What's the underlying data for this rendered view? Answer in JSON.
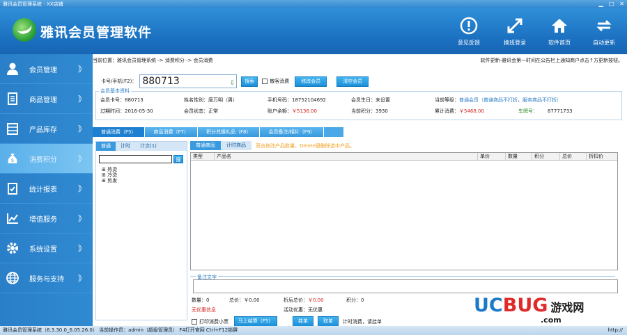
{
  "window": {
    "title": "雅讯会员管理系统 - XX店铺",
    "controls": [
      "▁",
      "□",
      "✕"
    ]
  },
  "app": {
    "title": "雅讯会员管理软件"
  },
  "header_buttons": [
    {
      "label": "意见反馈",
      "icon": "alert-icon"
    },
    {
      "label": "换班登录",
      "icon": "switch-icon"
    },
    {
      "label": "软件首页",
      "icon": "home-icon"
    },
    {
      "label": "自动更新",
      "icon": "refresh-icon"
    }
  ],
  "sidebar": {
    "items": [
      {
        "label": "会员管理",
        "icon": "user-icon"
      },
      {
        "label": "商品管理",
        "icon": "document-icon"
      },
      {
        "label": "产品库存",
        "icon": "inventory-icon"
      },
      {
        "label": "消费积分",
        "icon": "money-bag-icon",
        "active": true
      },
      {
        "label": "统计报表",
        "icon": "clipboard-icon"
      },
      {
        "label": "增值服务",
        "icon": "chart-icon"
      },
      {
        "label": "系统设置",
        "icon": "gear-icon"
      },
      {
        "label": "服务与支持",
        "icon": "globe-icon"
      }
    ],
    "arrow": "》"
  },
  "breadcrumb": "当前位置：雅讯会员管理系统 -> 消费积分 -> 会员消费",
  "notice": "软件更新-雅讯会第一时间在公告栏上通知商户点击↑方更新按钮。",
  "card": {
    "label": "卡号/手机(F2)：",
    "value": "880713",
    "search": "搜索",
    "anon_label": "散客消费",
    "edit_member": "修改会员",
    "clear_member": "清空会员"
  },
  "member": {
    "panel_title": "会员基本资料",
    "card_no_label": "会员卡号：",
    "card_no": "880713",
    "name_label": "姓名性别：",
    "name": "唐万明（男）",
    "phone_label": "手机号码：",
    "phone": "18752104692",
    "birthday_label": "会员生日：",
    "birthday": "未设置",
    "level_label": "当前等级：",
    "level": "普通会员（普通商品不打折，服务商品不打折）",
    "expire_label": "过期时间：",
    "expire": "2016-05-30",
    "status_label": "会员状态：",
    "status": "正常",
    "balance_label": "账户余额：",
    "balance": "￥5136.00",
    "points_label": "当前积分：",
    "points": "3930",
    "total_label": "累计消费：",
    "total": "￥5468.00",
    "plate_label": "车牌号：",
    "plate": "87771733"
  },
  "tabs": [
    "普通消费（F5）",
    "商品消费（F7）",
    "积分兑换礼品（F8）",
    "会员备注/相片（F9）"
  ],
  "left_tabs": [
    "普通",
    "计时",
    "计次(1)"
  ],
  "search_btn": "搜",
  "tree": [
    "热烫",
    "冷烫",
    "剪发"
  ],
  "right_tabs": [
    "普通商品",
    "计时商品"
  ],
  "hint": "双击修改产品数量，Delete键删除选中产品。",
  "grid_headers": [
    "类型",
    "产品名",
    "单价",
    "数量",
    "积分",
    "总价",
    "折扣价"
  ],
  "remark_title": "备注文字",
  "summary": {
    "qty_label": "数量：",
    "qty": "0",
    "total_label": "总价：",
    "total": "￥0.00",
    "discount_label": "折后总价：",
    "discount": "￥0.00",
    "points_label": "积分：",
    "points": "0",
    "no_discount": "无优惠信息",
    "promo_label": "活动优惠：",
    "promo": "无优惠"
  },
  "actions": {
    "print_label": "打印消费小票",
    "checkout": "马上结算（F5）",
    "hang": "挂单",
    "take": "取单",
    "timing_text": "计时消费，请挂单"
  },
  "statusbar": "雅讯会员管理系统（6.3.30.0_6.05.26.0）   当前操作员：admin（超级管理员）   F4打开官网 Ctrl+F12锁屏",
  "statusbar_right": "http://",
  "watermark": {
    "part1": "UC",
    "part2": "BUG",
    "part3": "游戏网",
    "part4": ".com"
  }
}
